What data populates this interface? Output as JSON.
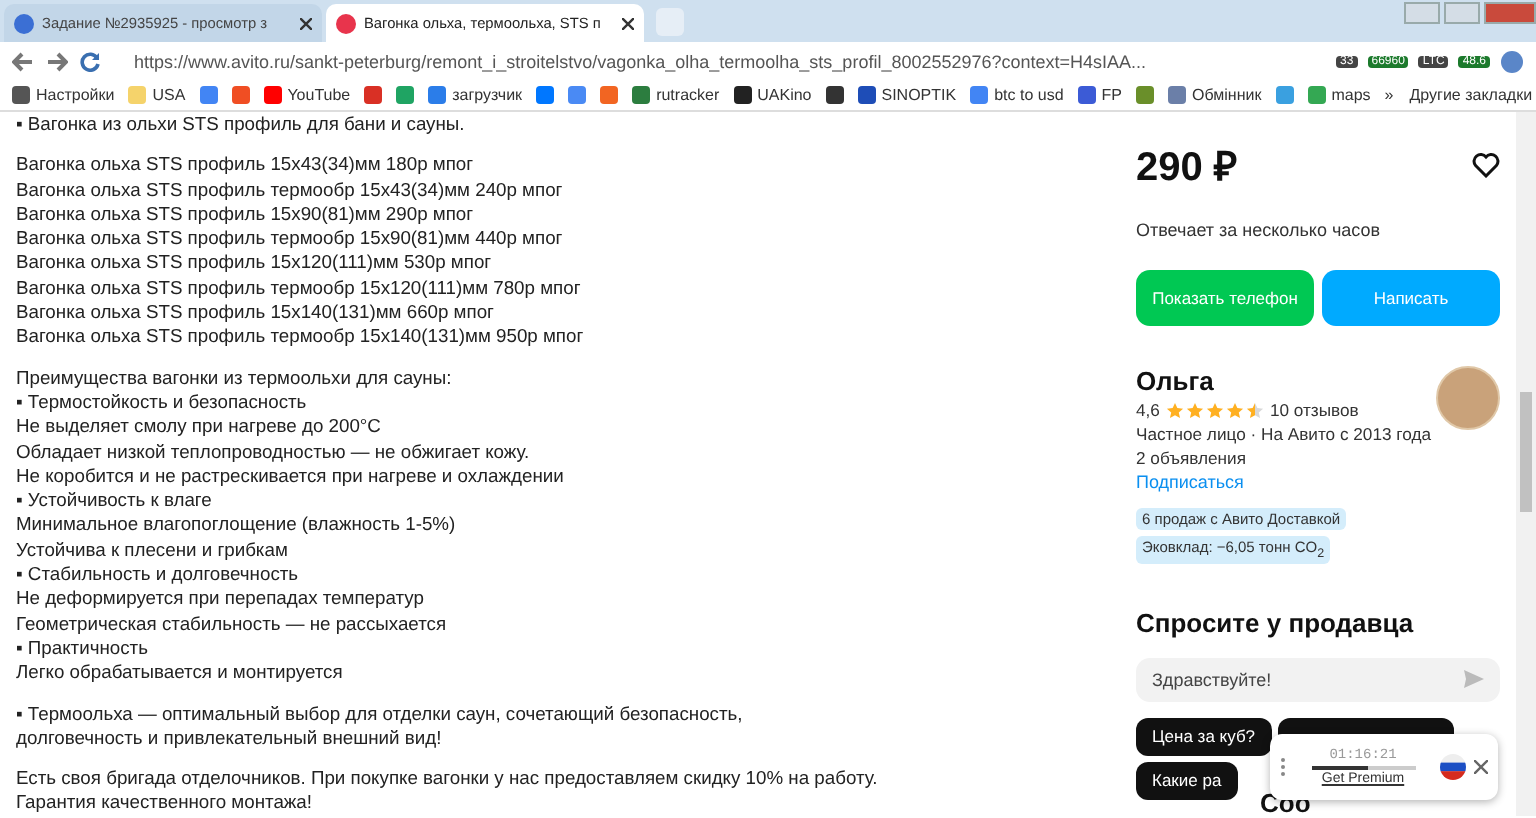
{
  "browser": {
    "tabs": [
      {
        "title": "Задание №2935925 - просмотр з",
        "selected": false,
        "color": "#3b6fd4"
      },
      {
        "title": "Вагонка ольха, термоольха, STS п",
        "selected": true,
        "color": "#e8344c"
      }
    ],
    "address_bar": {
      "url": "https://www.avito.ru/sankt-peterburg/remont_i_stroitelstvo/vagonka_olha_termoolha_sts_profil_8002552976?context=H4sIAA..."
    },
    "extension_badges": [
      "33",
      "66960",
      "LTC",
      "48.6"
    ],
    "bookmarks": [
      {
        "label": "Настройки",
        "color": "#555555"
      },
      {
        "label": "USA",
        "color": "#f5d36b"
      },
      {
        "color": "#4285f4"
      },
      {
        "color": "#f04e23"
      },
      {
        "label": "YouTube",
        "color": "#ff0000"
      },
      {
        "color": "#d93025"
      },
      {
        "color": "#1fa463"
      },
      {
        "label": "загрузчик",
        "color": "#2b7de9"
      },
      {
        "color": "#0077ff"
      },
      {
        "color": "#4a8af4"
      },
      {
        "color": "#f26522"
      },
      {
        "label": "rutracker",
        "color": "#2c7d3f"
      },
      {
        "label": "UAKino",
        "color": "#222222"
      },
      {
        "color": "#333333"
      },
      {
        "label": "SINOPTIK",
        "color": "#1e4db7"
      },
      {
        "label": "btc to usd",
        "color": "#4285f4"
      },
      {
        "label": "FP",
        "color": "#3c5bd6"
      },
      {
        "color": "#6a8f2a"
      },
      {
        "label": "Обмінник",
        "color": "#6b7fa8"
      },
      {
        "color": "#3aa0e0"
      },
      {
        "label": "maps",
        "color": "#34a853"
      }
    ],
    "overflow": "»",
    "other_bookmarks": "Другие закладки"
  },
  "description": [
    [
      "▪ Вагонка из ольхи STS профиль для бани и сауны."
    ],
    [
      "Вагонка ольха STS профиль 15х43(34)мм 180р мпог",
      "Вагонка ольха STS профиль термообр 15х43(34)мм 240р мпог",
      "Вагонка ольха STS профиль 15х90(81)мм 290р мпог",
      "Вагонка ольха STS профиль термообр 15х90(81)мм 440р мпог",
      "Вагонка ольха STS профиль 15х120(111)мм 530р мпог",
      "Вагонка ольха STS профиль термообр 15х120(111)мм 780р мпог",
      "Вагонка ольха STS профиль 15х140(131)мм 660р мпог",
      "Вагонка ольха STS профиль термообр 15х140(131)мм 950р мпог"
    ],
    [
      "Преимущества вагонки из термоольхи для сауны:",
      "▪ Термостойкость и безопасность",
      "Не выделяет смолу при нагреве до 200°C",
      "Обладает низкой теплопроводностью — не обжигает кожу.",
      "Не коробится и не растрескивается при нагреве и охлаждении",
      "▪ Устойчивость к влаге",
      "Минимальное влагопоглощение (влажность 1-5%)",
      "Устойчива к плесени и грибкам",
      "▪ Стабильность и долговечность",
      "Не деформируется при перепадах температур",
      "Геометрическая стабильность — не рассыхается",
      "▪ Практичность",
      "Легко обрабатывается и монтируется"
    ],
    [
      "▪ Термоольха — оптимальный выбор для отделки саун, сочетающий безопасность, долговечность и привлекательный внешний вид!"
    ],
    [
      "Есть своя бригада отделочников. При покупке вагонки у нас предоставляем скидку 10% на работу.",
      "Гарантия качественного монтажа!"
    ]
  ],
  "sidebar": {
    "price": "290 ₽",
    "favorite": false,
    "response_time": "Отвечает за несколько часов",
    "buttons": [
      {
        "label": "Показать телефон",
        "kind": "phone"
      },
      {
        "label": "Написать",
        "kind": "message"
      }
    ],
    "seller": {
      "name": "Ольга",
      "rating": "4,6",
      "stars": 4.5,
      "reviews": "10 отзывов",
      "type": "Частное лицо · На Авито с 2013 года",
      "listings": "2 объявления",
      "subscribe": "Подписаться"
    },
    "badges": [
      "6 продаж с Авито Доставкой",
      "Эковклад: −6,05 тонн CO$_{2}$"
    ],
    "ask_heading": "Спросите у продавца",
    "message_field": {
      "value": "Здравствуйте!"
    },
    "quick_replies": [
      {
        "kind": "text",
        "label": "Цена за куб?"
      },
      {
        "kind": "covered"
      },
      {
        "kind": "text",
        "label": "Какие ра"
      }
    ],
    "next_heading": "Соо"
  },
  "player_widget": {
    "time": "01:16:21",
    "level": 0.55,
    "link": "Get Premium"
  }
}
